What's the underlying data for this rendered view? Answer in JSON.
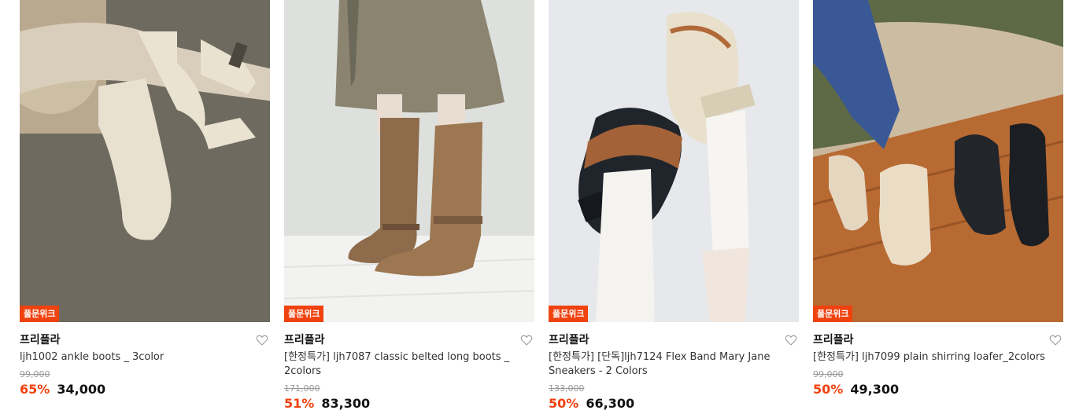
{
  "products": [
    {
      "badge": "풀문위크",
      "brand": "프리플라",
      "name": "ljh1002 ankle boots _ 3color",
      "original_price": "99,000",
      "discount": "65%",
      "price": "34,000",
      "image": "cream ankle boots on carpet"
    },
    {
      "badge": "풀문위크",
      "brand": "프리플라",
      "name": "[한정특가] ljh7087 classic belted long boots _ 2colors",
      "original_price": "171,000",
      "discount": "51%",
      "price": "83,300",
      "image": "brown suede long boots"
    },
    {
      "badge": "풀문위크",
      "brand": "프리플라",
      "name": "[한정특가] [단독]ljh7124 Flex Band Mary Jane Sneakers - 2 Colors",
      "original_price": "133,000",
      "discount": "50%",
      "price": "66,300",
      "image": "mary jane sneakers black and cream"
    },
    {
      "badge": "풀문위크",
      "brand": "프리플라",
      "name": "[한정특가] ljh7099 plain shirring loafer_2colors",
      "original_price": "99,000",
      "discount": "50%",
      "price": "49,300",
      "image": "cream and black loafers on wood"
    }
  ],
  "colors": {
    "accent": "#f0420f",
    "text": "#111111",
    "muted": "#999999"
  },
  "icons": {
    "wishlist": "heart-outline-icon"
  }
}
